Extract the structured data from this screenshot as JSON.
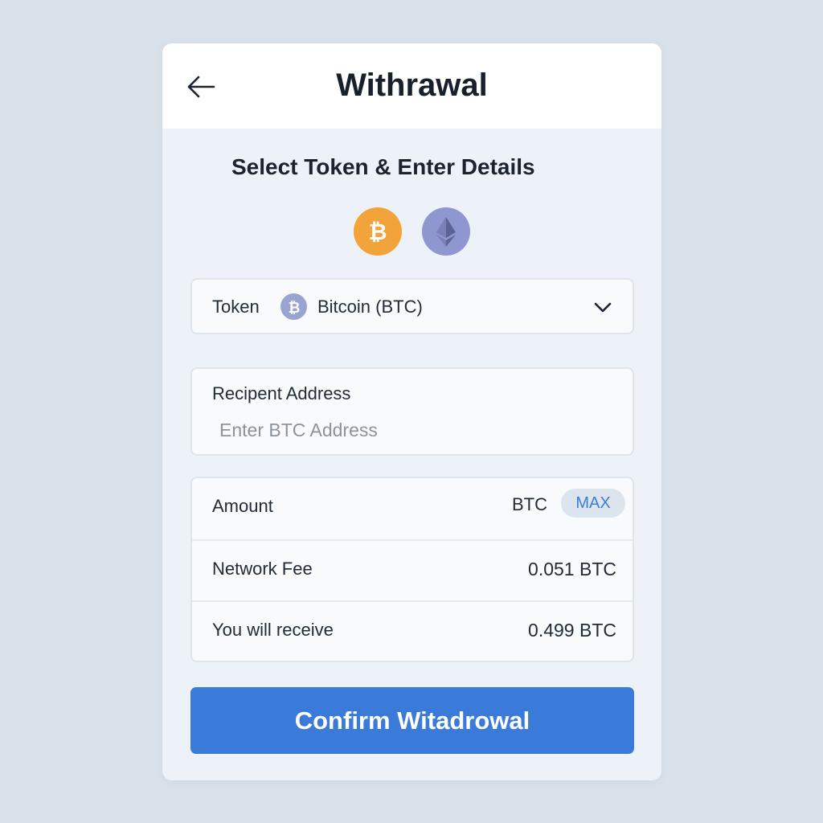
{
  "header": {
    "title": "Withrawal",
    "back_icon": "arrow-left-icon"
  },
  "subtitle": "Select Token & Enter Details",
  "token_choices": [
    {
      "name": "bitcoin",
      "icon": "bitcoin-icon",
      "color": "#f2a33a"
    },
    {
      "name": "ethereum",
      "icon": "ethereum-icon",
      "color": "#8f97d0"
    }
  ],
  "token_select": {
    "label": "Token",
    "value": "Bitcoin (BTC)",
    "icon": "bitcoin-icon",
    "dropdown_icon": "chevron-down-icon"
  },
  "recipient": {
    "label": "Recipent Address",
    "placeholder": "Enter BTC Address",
    "value": ""
  },
  "amount": {
    "label": "Amount",
    "value": "",
    "unit": "BTC",
    "max_label": "MAX"
  },
  "network_fee": {
    "label": "Network Fee",
    "value": "0.051 BTC"
  },
  "receive": {
    "label": "You will receive",
    "value": "0.499 BTC"
  },
  "confirm_label": "Confirm Witadrowal",
  "colors": {
    "accent": "#3a7ad8",
    "bitcoin": "#f2a33a",
    "ethereum": "#8f97d0",
    "background": "#d9e2ea"
  }
}
